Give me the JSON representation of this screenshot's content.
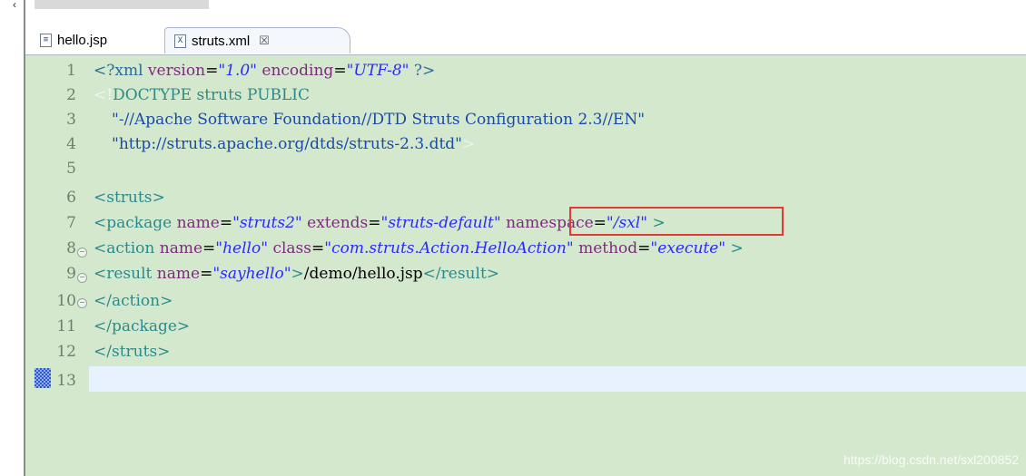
{
  "tabs": [
    {
      "label": "hello.jsp",
      "icon": "jsp-file-icon"
    },
    {
      "label": "struts.xml",
      "icon": "xml-file-icon",
      "close": "☒"
    }
  ],
  "line_numbers": [
    "1",
    "2",
    "3",
    "4",
    "5",
    "6",
    "7",
    "8",
    "9",
    "10",
    "11",
    "12",
    "13"
  ],
  "lines": {
    "l1": {
      "open": "<?xml",
      "a1": " version",
      "eq1": "=",
      "v1": "\"1.0\"",
      "a2": " encoding",
      "eq2": "=",
      "v2": "\"UTF-8\"",
      "close": " ?>"
    },
    "l2": {
      "open": "<!",
      "doctype": "DOCTYPE",
      "s1": " struts",
      "pub": " PUBLIC"
    },
    "l3": {
      "text": "\"-//Apache Software Foundation//DTD Struts Configuration 2.3//EN\""
    },
    "l4": {
      "text": "\"http://struts.apache.org/dtds/struts-2.3.dtd\"",
      "end": ">"
    },
    "l6": {
      "open": "<",
      "tag": "struts",
      "close": ">"
    },
    "l7": {
      "open": "<",
      "tag": "package",
      "a1": " name",
      "eq1": "=",
      "v1": "\"struts2\"",
      "a2": " extends",
      "eq2": "=",
      "v2": "\"struts-default\"",
      "a3": " namespace",
      "eq3": "=",
      "v3": "\"/sxl\"",
      "close": " >"
    },
    "l8": {
      "open": "<",
      "tag": "action",
      "a1": " name",
      "eq1": "=",
      "v1": "\"hello\"",
      "a2": " class",
      "eq2": "=",
      "v2": "\"com.struts.Action.HelloAction\"",
      "a3": " method",
      "eq3": "=",
      "v3": "\"execute\"",
      "close": " >"
    },
    "l9": {
      "open": "<",
      "tag": "result",
      "a1": " name",
      "eq1": "=",
      "v1": "\"sayhello\"",
      "gt": ">",
      "content": "/demo/hello.jsp",
      "endopen": "</",
      "endtag": "result",
      "endclose": ">"
    },
    "l10": {
      "open": "</",
      "tag": "action",
      "close": ">"
    },
    "l11": {
      "open": "</",
      "tag": "package",
      "close": ">"
    },
    "l12": {
      "open": "</",
      "tag": "struts",
      "close": ">"
    }
  },
  "watermark": "https://blog.csdn.net/sxl200852",
  "colors": {
    "editor_bg": "#d4e8cd",
    "highlight_border": "#e53935"
  }
}
